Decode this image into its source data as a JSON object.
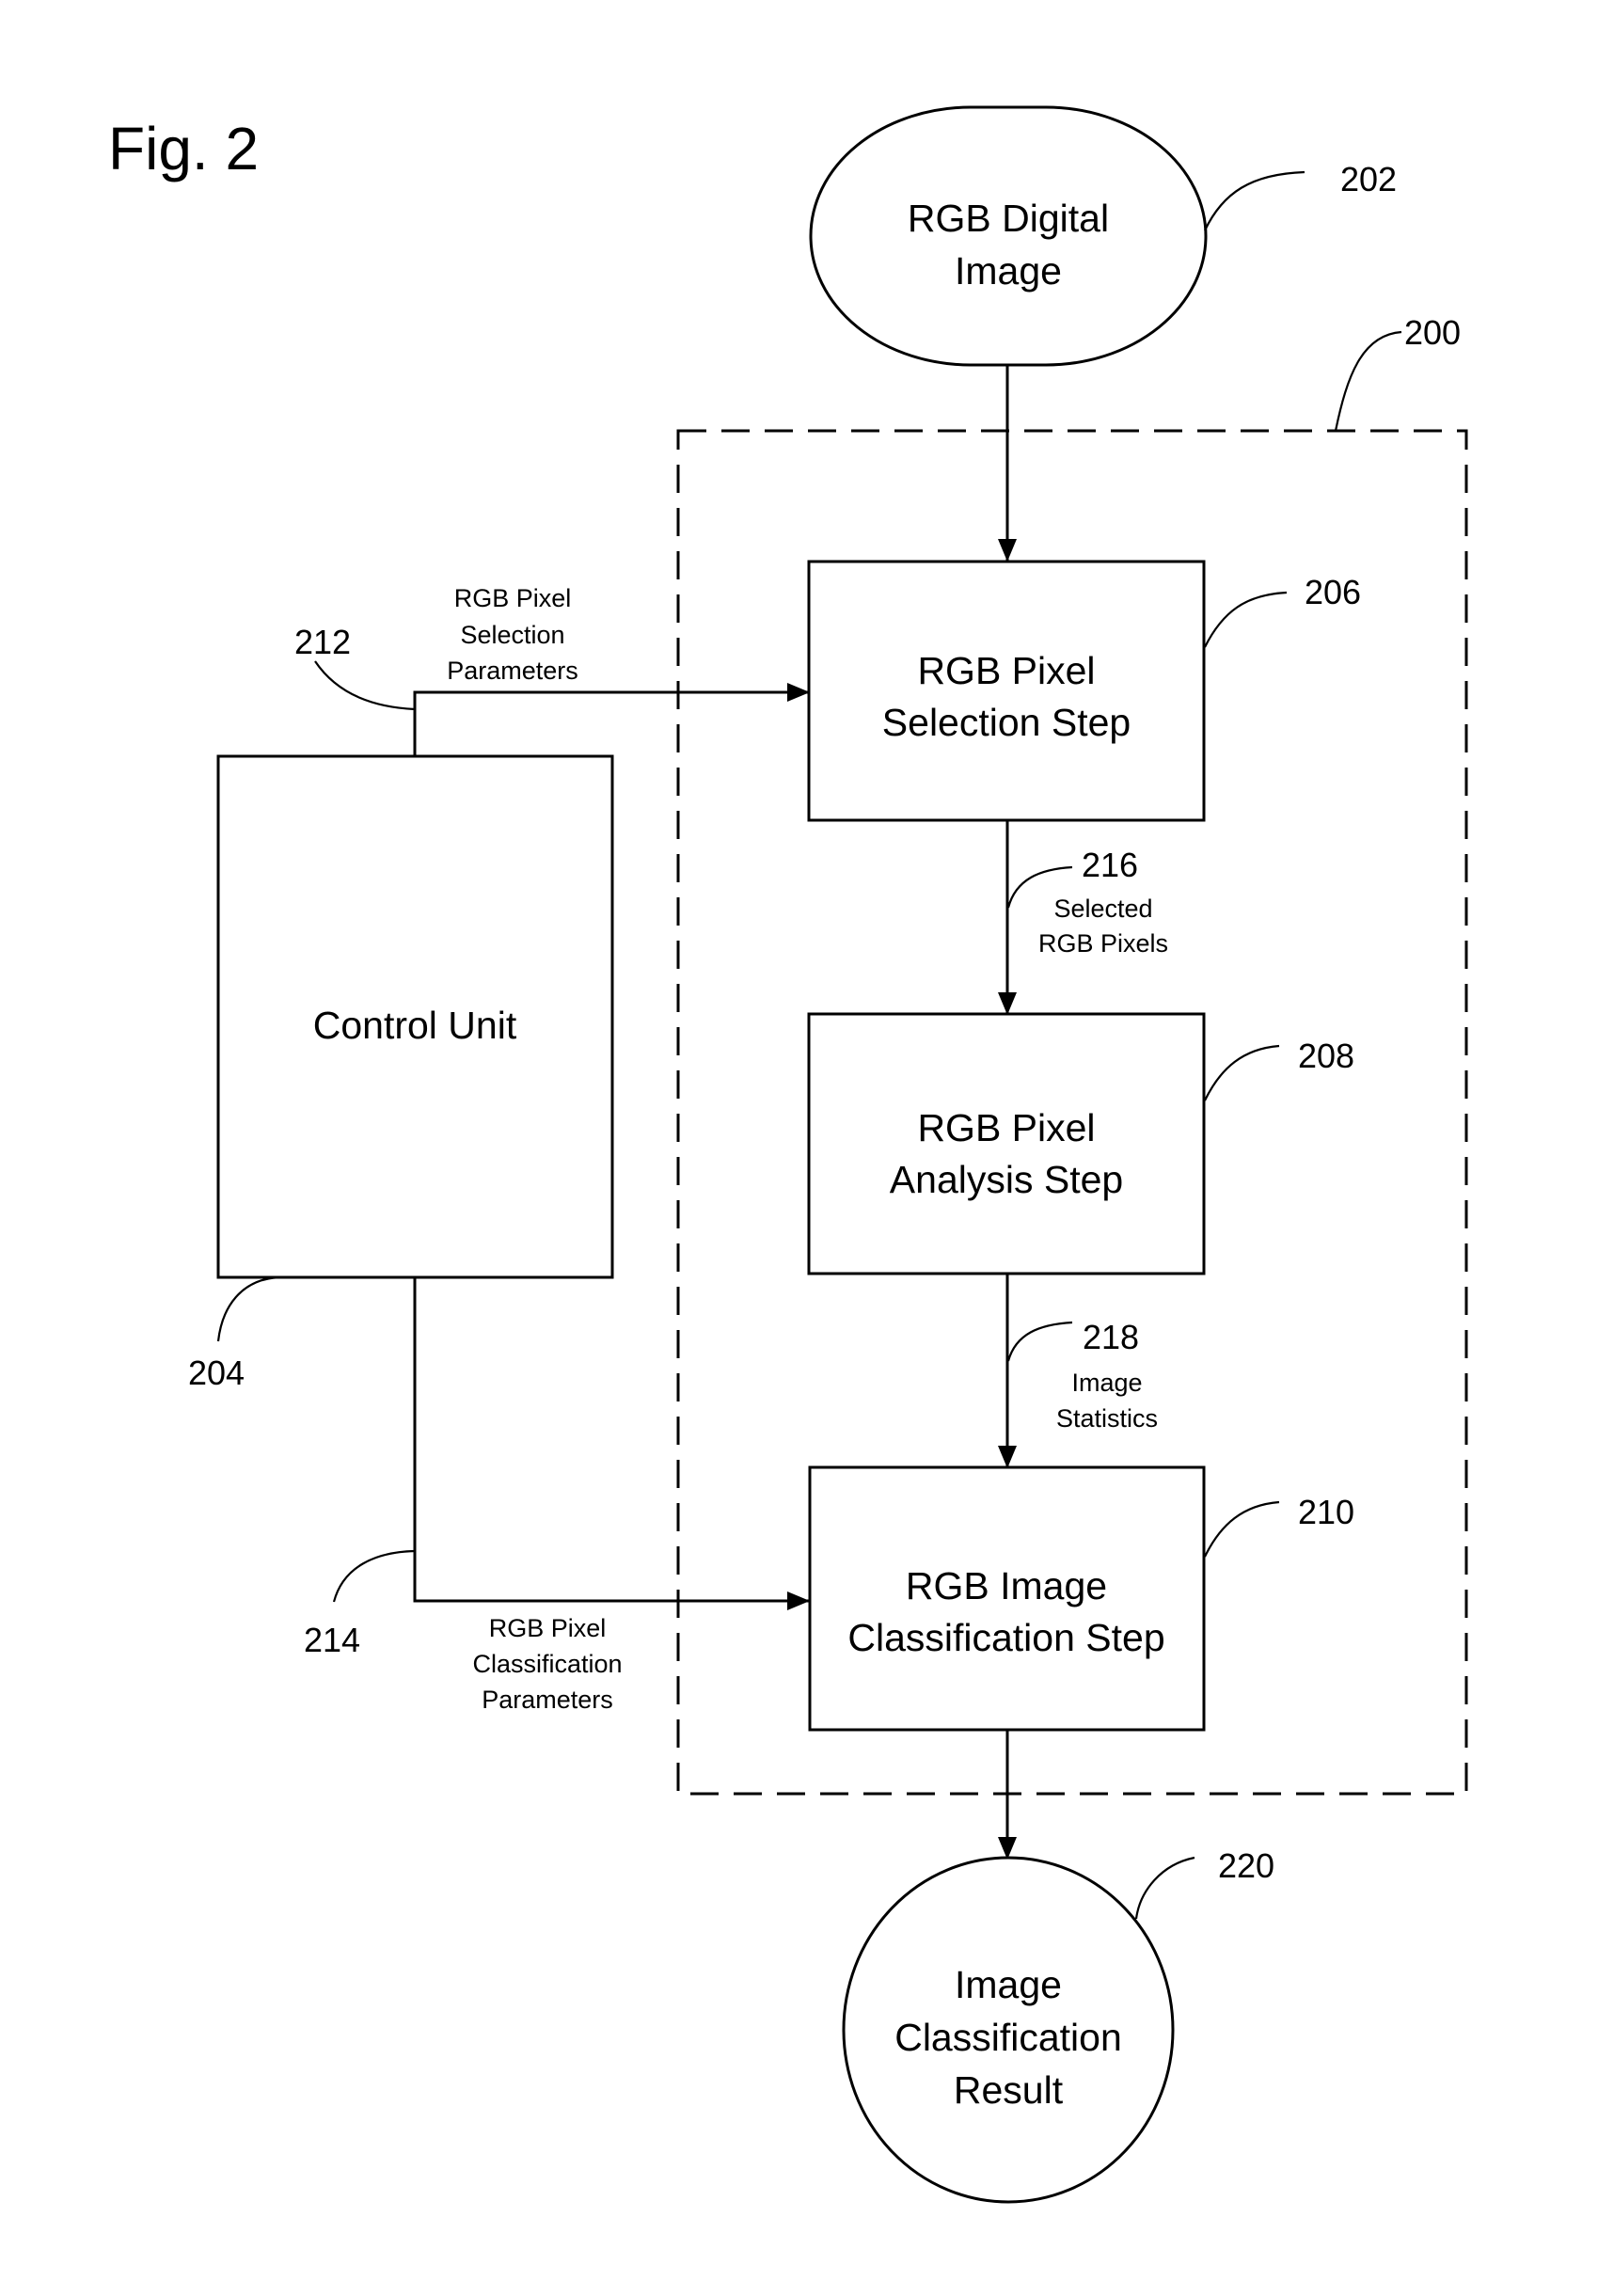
{
  "figure": {
    "title": "Fig. 2",
    "boundary": {
      "ref": "200"
    },
    "nodes": {
      "input_image": {
        "ref": "202",
        "lines": [
          "RGB Digital",
          "Image"
        ],
        "shape": "terminal"
      },
      "control_unit": {
        "ref": "204",
        "lines": [
          "Control Unit"
        ],
        "shape": "rectangle"
      },
      "selection_step": {
        "ref": "206",
        "lines": [
          "RGB Pixel",
          "Selection Step"
        ],
        "shape": "rectangle"
      },
      "analysis_step": {
        "ref": "208",
        "lines": [
          "RGB Pixel",
          "Analysis Step"
        ],
        "shape": "rectangle"
      },
      "classification_step": {
        "ref": "210",
        "lines": [
          "RGB Image",
          "Classification Step"
        ],
        "shape": "rectangle"
      },
      "result": {
        "ref": "220",
        "lines": [
          "Image",
          "Classification",
          "Result"
        ],
        "shape": "circle"
      }
    },
    "edges": {
      "selection_params": {
        "ref": "212",
        "from": "control_unit",
        "to": "selection_step",
        "lines": [
          "RGB Pixel",
          "Selection",
          "Parameters"
        ]
      },
      "classification_params": {
        "ref": "214",
        "from": "control_unit",
        "to": "classification_step",
        "lines": [
          "RGB Pixel",
          "Classification",
          "Parameters"
        ]
      },
      "selected_pixels": {
        "ref": "216",
        "from": "selection_step",
        "to": "analysis_step",
        "lines": [
          "Selected",
          "RGB Pixels"
        ]
      },
      "image_statistics": {
        "ref": "218",
        "from": "analysis_step",
        "to": "classification_step",
        "lines": [
          "Image",
          "Statistics"
        ]
      },
      "image_to_selection": {
        "from": "input_image",
        "to": "selection_step"
      },
      "classification_to_result": {
        "from": "classification_step",
        "to": "result"
      }
    },
    "colors": {
      "ink": "#000000",
      "paper": "#ffffff"
    }
  }
}
